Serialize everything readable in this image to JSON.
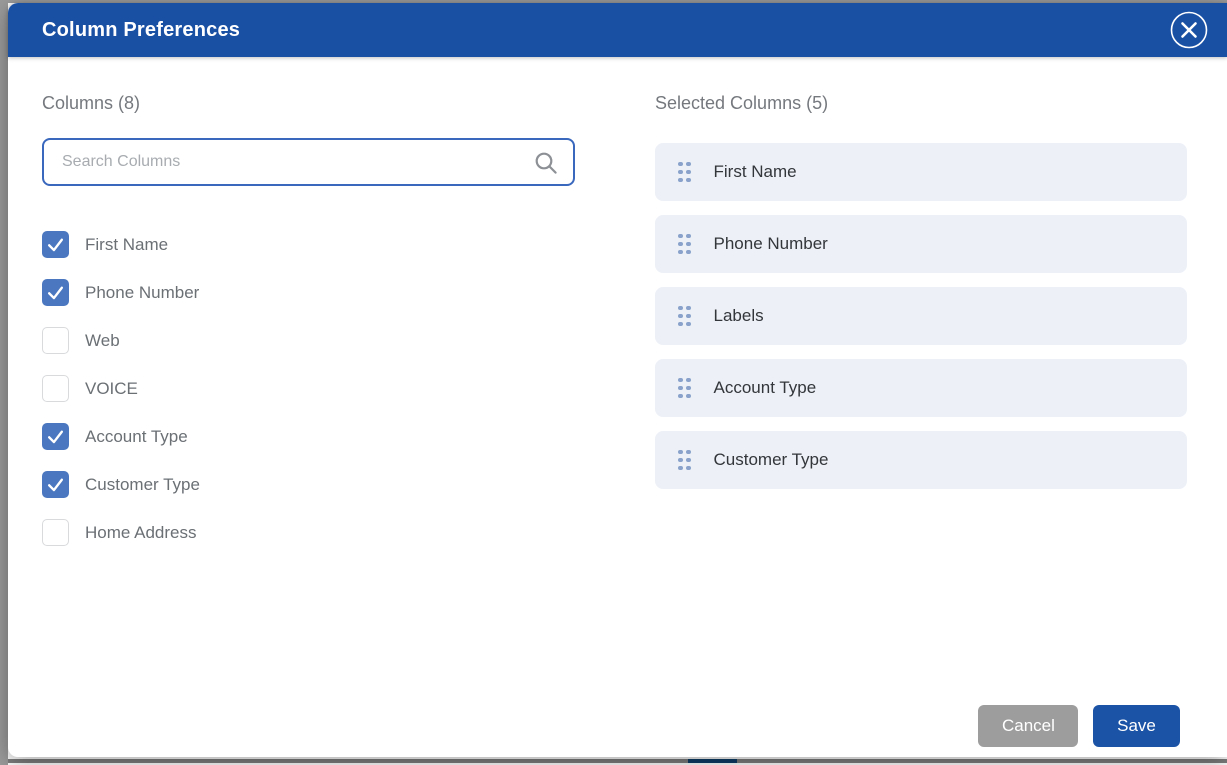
{
  "modal": {
    "title": "Column Preferences"
  },
  "columns_panel": {
    "heading": "Columns (8)",
    "count": 8,
    "search": {
      "placeholder": "Search Columns",
      "value": ""
    },
    "items": [
      {
        "label": "First Name",
        "checked": true
      },
      {
        "label": "Phone Number",
        "checked": true
      },
      {
        "label": "Web",
        "checked": false
      },
      {
        "label": "VOICE",
        "checked": false
      },
      {
        "label": "Account Type",
        "checked": true
      },
      {
        "label": "Customer Type",
        "checked": true
      },
      {
        "label": "Home Address",
        "checked": false
      }
    ]
  },
  "selected_panel": {
    "heading": "Selected Columns (5)",
    "count": 5,
    "items": [
      {
        "label": "First Name"
      },
      {
        "label": "Phone Number"
      },
      {
        "label": "Labels"
      },
      {
        "label": "Account Type"
      },
      {
        "label": "Customer Type"
      }
    ]
  },
  "footer": {
    "cancel_label": "Cancel",
    "save_label": "Save"
  },
  "colors": {
    "header_blue": "#1a50a4",
    "checkbox_blue": "#4a77bf",
    "search_border_blue": "#3a68bd",
    "selected_item_bg": "#edf1f7",
    "drag_dot_blue": "#8aa2cb",
    "save_blue": "#1b53a6",
    "cancel_gray": "#9d9d9d",
    "bottom_bar_gray": "#7f7f7f",
    "bottom_bar_navy": "#0d3c68"
  }
}
